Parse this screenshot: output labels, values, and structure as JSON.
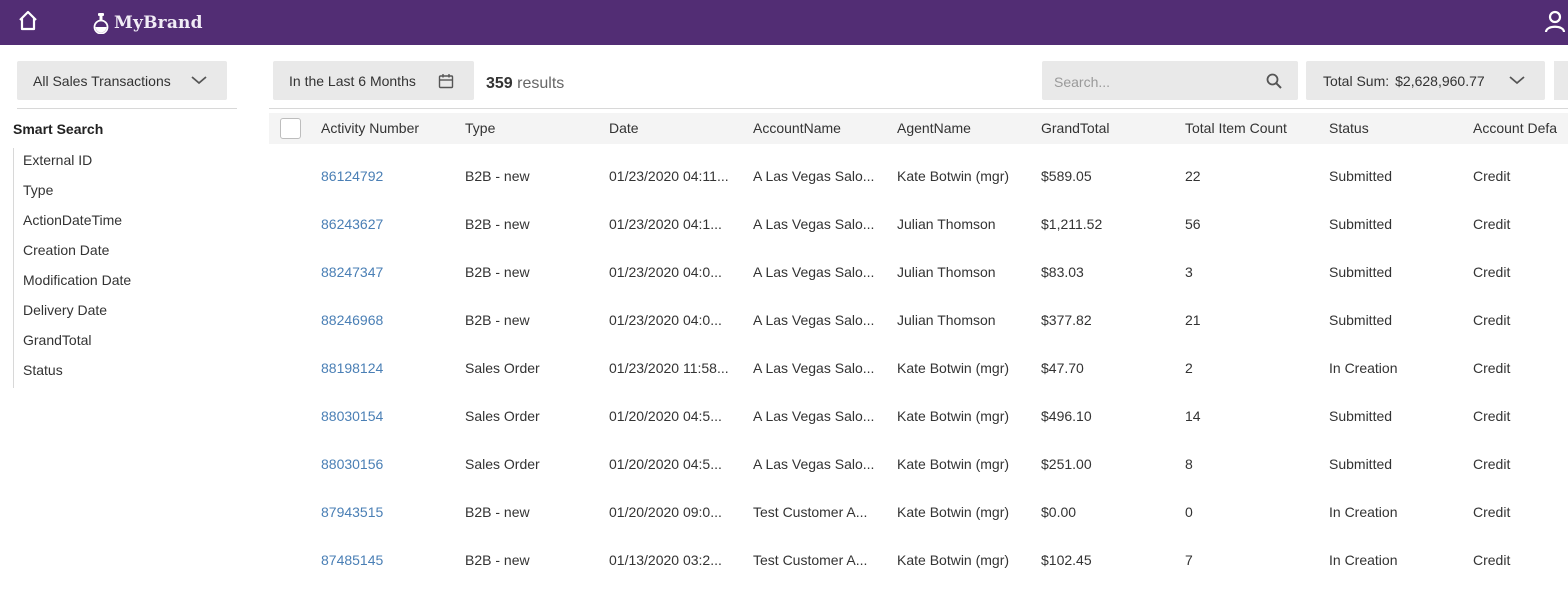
{
  "header": {
    "brand": "MyBrand",
    "home_icon": "home-icon",
    "user_icon": "user-icon",
    "bar_color": "#522d74"
  },
  "sidebar": {
    "list_select": "All Sales Transactions",
    "smart_search_title": "Smart Search",
    "fields": [
      "External ID",
      "Type",
      "ActionDateTime",
      "Creation Date",
      "Modification Date",
      "Delivery Date",
      "GrandTotal",
      "Status"
    ]
  },
  "toolbar": {
    "date_filter": "In the Last 6 Months",
    "results_count": "359",
    "results_label": "results",
    "search_placeholder": "Search...",
    "total_sum_label": "Total Sum:",
    "total_sum_value": "$2,628,960.77"
  },
  "table": {
    "columns": [
      "Activity Number",
      "Type",
      "Date",
      "AccountName",
      "AgentName",
      "GrandTotal",
      "Total Item Count",
      "Status",
      "Account Defa"
    ],
    "link_color": "#4a7fb5",
    "rows": [
      [
        "86124792",
        "B2B - new",
        "01/23/2020 04:11...",
        "A Las Vegas Salo...",
        "Kate Botwin (mgr)",
        "$589.05",
        "22",
        "Submitted",
        "Credit"
      ],
      [
        "86243627",
        "B2B - new",
        "01/23/2020 04:1...",
        "A Las Vegas Salo...",
        "Julian Thomson",
        "$1,211.52",
        "56",
        "Submitted",
        "Credit"
      ],
      [
        "88247347",
        "B2B - new",
        "01/23/2020 04:0...",
        "A Las Vegas Salo...",
        "Julian Thomson",
        "$83.03",
        "3",
        "Submitted",
        "Credit"
      ],
      [
        "88246968",
        "B2B - new",
        "01/23/2020 04:0...",
        "A Las Vegas Salo...",
        "Julian Thomson",
        "$377.82",
        "21",
        "Submitted",
        "Credit"
      ],
      [
        "88198124",
        "Sales Order",
        "01/23/2020 11:58...",
        "A Las Vegas Salo...",
        "Kate Botwin (mgr)",
        "$47.70",
        "2",
        "In Creation",
        "Credit"
      ],
      [
        "88030154",
        "Sales Order",
        "01/20/2020 04:5...",
        "A Las Vegas Salo...",
        "Kate Botwin (mgr)",
        "$496.10",
        "14",
        "Submitted",
        "Credit"
      ],
      [
        "88030156",
        "Sales Order",
        "01/20/2020 04:5...",
        "A Las Vegas Salo...",
        "Kate Botwin (mgr)",
        "$251.00",
        "8",
        "Submitted",
        "Credit"
      ],
      [
        "87943515",
        "B2B - new",
        "01/20/2020 09:0...",
        "Test Customer A...",
        "Kate Botwin (mgr)",
        "$0.00",
        "0",
        "In Creation",
        "Credit"
      ],
      [
        "87485145",
        "B2B - new",
        "01/13/2020 03:2...",
        "Test Customer A...",
        "Kate Botwin (mgr)",
        "$102.45",
        "7",
        "In Creation",
        "Credit"
      ]
    ]
  }
}
